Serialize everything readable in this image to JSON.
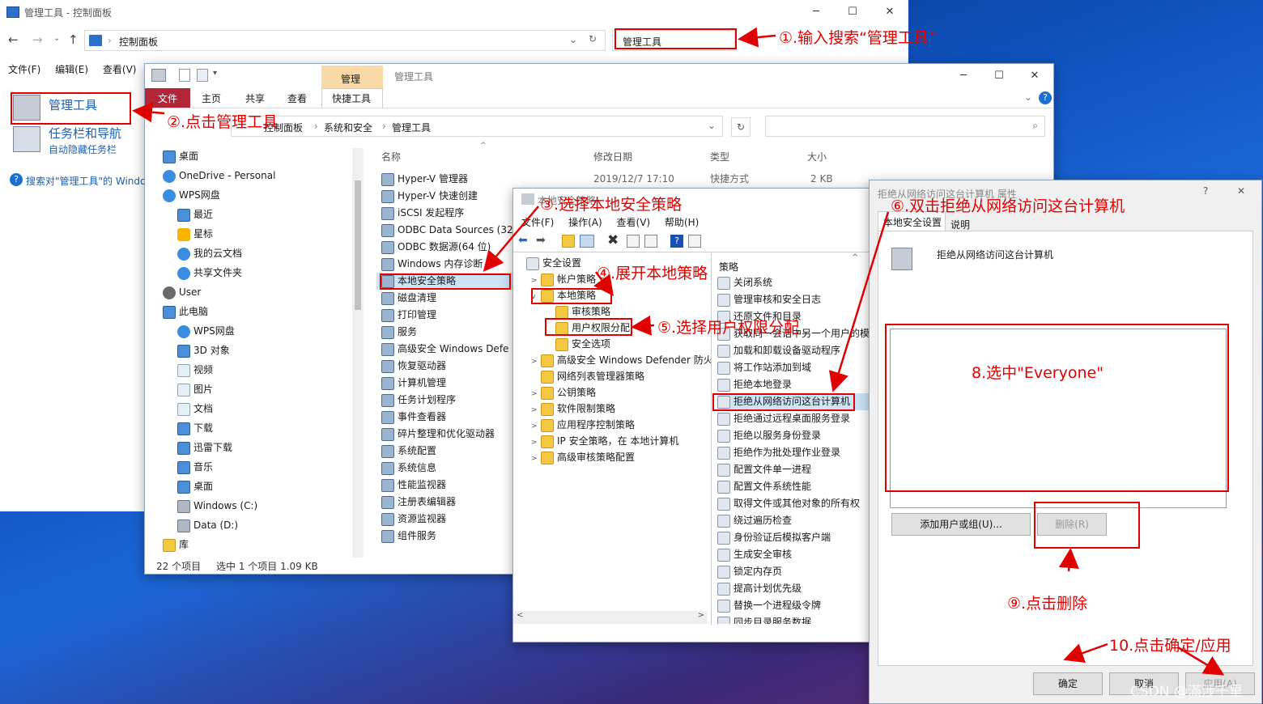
{
  "colors": {
    "accent": "#e00000",
    "ribbon_file": "#b3263a",
    "tab_manage": "#f9d9a6"
  },
  "cp": {
    "title": "管理工具 - 控制面板",
    "address": "控制面板",
    "search_value": "管理工具",
    "menu": [
      "文件(F)",
      "编辑(E)",
      "查看(V)"
    ],
    "item1_title": "管理工具",
    "item2_title": "任务栏和导航",
    "item2_sub": "自动隐藏任务栏",
    "search_link": "搜索对\"管理工具\"的 Windo"
  },
  "explorer": {
    "title": "管理工具",
    "tab_manage": "管理",
    "ribbon": [
      "文件",
      "主页",
      "共享",
      "查看",
      "快捷工具"
    ],
    "breadcrumb": [
      "控制面板",
      "系统和安全",
      "管理工具"
    ],
    "nav": [
      {
        "icon": "pc",
        "label": "桌面"
      },
      {
        "icon": "cloud",
        "label": "OneDrive - Personal"
      },
      {
        "icon": "cloud",
        "label": "WPS网盘"
      },
      {
        "icon": "pc",
        "label": "最近"
      },
      {
        "icon": "star",
        "label": "星标"
      },
      {
        "icon": "cloud",
        "label": "我的云文档"
      },
      {
        "icon": "cloud",
        "label": "共享文件夹"
      },
      {
        "icon": "user",
        "label": "User"
      },
      {
        "icon": "pc",
        "label": "此电脑"
      },
      {
        "icon": "cloud",
        "label": "WPS网盘"
      },
      {
        "icon": "pc",
        "label": "3D 对象"
      },
      {
        "icon": "doc",
        "label": "视频"
      },
      {
        "icon": "doc",
        "label": "图片"
      },
      {
        "icon": "doc",
        "label": "文档"
      },
      {
        "icon": "pc",
        "label": "下载"
      },
      {
        "icon": "pc",
        "label": "迅雷下载"
      },
      {
        "icon": "pc",
        "label": "音乐"
      },
      {
        "icon": "pc",
        "label": "桌面"
      },
      {
        "icon": "drive",
        "label": "Windows (C:)"
      },
      {
        "icon": "drive",
        "label": "Data (D:)"
      },
      {
        "icon": "folder",
        "label": "库"
      }
    ],
    "columns": [
      "名称",
      "修改日期",
      "类型",
      "大小"
    ],
    "files": [
      {
        "name": "Hyper-V 管理器",
        "date": "2019/12/7 17:10",
        "type": "快捷方式",
        "size": "2 KB"
      },
      {
        "name": "Hyper-V 快速创建"
      },
      {
        "name": "iSCSI 发起程序"
      },
      {
        "name": "ODBC Data Sources (32"
      },
      {
        "name": "ODBC 数据源(64 位)"
      },
      {
        "name": "Windows 内存诊断"
      },
      {
        "name": "本地安全策略"
      },
      {
        "name": "磁盘清理"
      },
      {
        "name": "打印管理"
      },
      {
        "name": "服务"
      },
      {
        "name": "高级安全 Windows Defe"
      },
      {
        "name": "恢复驱动器"
      },
      {
        "name": "计算机管理"
      },
      {
        "name": "任务计划程序"
      },
      {
        "name": "事件查看器"
      },
      {
        "name": "碎片整理和优化驱动器"
      },
      {
        "name": "系统配置"
      },
      {
        "name": "系统信息"
      },
      {
        "name": "性能监视器"
      },
      {
        "name": "注册表编辑器"
      },
      {
        "name": "资源监视器"
      },
      {
        "name": "组件服务"
      }
    ],
    "status_count": "22 个项目",
    "status_sel": "选中 1 个项目  1.09 KB"
  },
  "secpol": {
    "title": "本地安全策略",
    "menu": [
      "文件(F)",
      "操作(A)",
      "查看(V)",
      "帮助(H)"
    ],
    "tree": [
      {
        "label": "安全设置",
        "lvl": 0,
        "tri": ""
      },
      {
        "label": "帐户策略",
        "lvl": 1,
        "tri": ">"
      },
      {
        "label": "本地策略",
        "lvl": 1,
        "tri": "v"
      },
      {
        "label": "审核策略",
        "lvl": 2,
        "tri": ""
      },
      {
        "label": "用户权限分配",
        "lvl": 2,
        "tri": ""
      },
      {
        "label": "安全选项",
        "lvl": 2,
        "tri": ""
      },
      {
        "label": "高级安全 Windows Defender 防火墙",
        "lvl": 1,
        "tri": ">"
      },
      {
        "label": "网络列表管理器策略",
        "lvl": 1,
        "tri": ""
      },
      {
        "label": "公钥策略",
        "lvl": 1,
        "tri": ">"
      },
      {
        "label": "软件限制策略",
        "lvl": 1,
        "tri": ">"
      },
      {
        "label": "应用程序控制策略",
        "lvl": 1,
        "tri": ">"
      },
      {
        "label": "IP 安全策略，在 本地计算机",
        "lvl": 1,
        "tri": ">"
      },
      {
        "label": "高级审核策略配置",
        "lvl": 1,
        "tri": ">"
      }
    ],
    "policy_header": "策略",
    "policies": [
      "关闭系统",
      "管理审核和安全日志",
      "还原文件和目录",
      "获取同一会话中另一个用户的模",
      "加载和卸载设备驱动程序",
      "将工作站添加到域",
      "拒绝本地登录",
      "拒绝从网络访问这台计算机",
      "拒绝通过远程桌面服务登录",
      "拒绝以服务身份登录",
      "拒绝作为批处理作业登录",
      "配置文件单一进程",
      "配置文件系统性能",
      "取得文件或其他对象的所有权",
      "绕过遍历检查",
      "身份验证后模拟客户端",
      "生成安全审核",
      "锁定内存页",
      "提高计划优先级",
      "替换一个进程级令牌",
      "同步目录服务数据"
    ]
  },
  "props": {
    "title": "拒绝从网络访问这台计算机 属性",
    "tabs": [
      "本地安全设置",
      "说明"
    ],
    "policy_name": "拒绝从网络访问这台计算机",
    "add_btn": "添加用户或组(U)...",
    "del_btn": "删除(R)",
    "ok_btn": "确定",
    "cancel_btn": "取消",
    "apply_btn": "应用(A)"
  },
  "annotations": {
    "a1": "①.输入搜索“管理工具”",
    "a2": "②.点击管理工具",
    "a3": "③.选择本地安全策略",
    "a4": "④.展开本地策略",
    "a5": "⑤.选择用户权限分配",
    "a6": "⑥.双击拒绝从网络访问这台计算机",
    "a8": "8.选中\"Everyone\"",
    "a9": "⑨.点击删除",
    "a10": "10.点击确定/应用"
  },
  "watermark": "CSDN @滿涉千里"
}
